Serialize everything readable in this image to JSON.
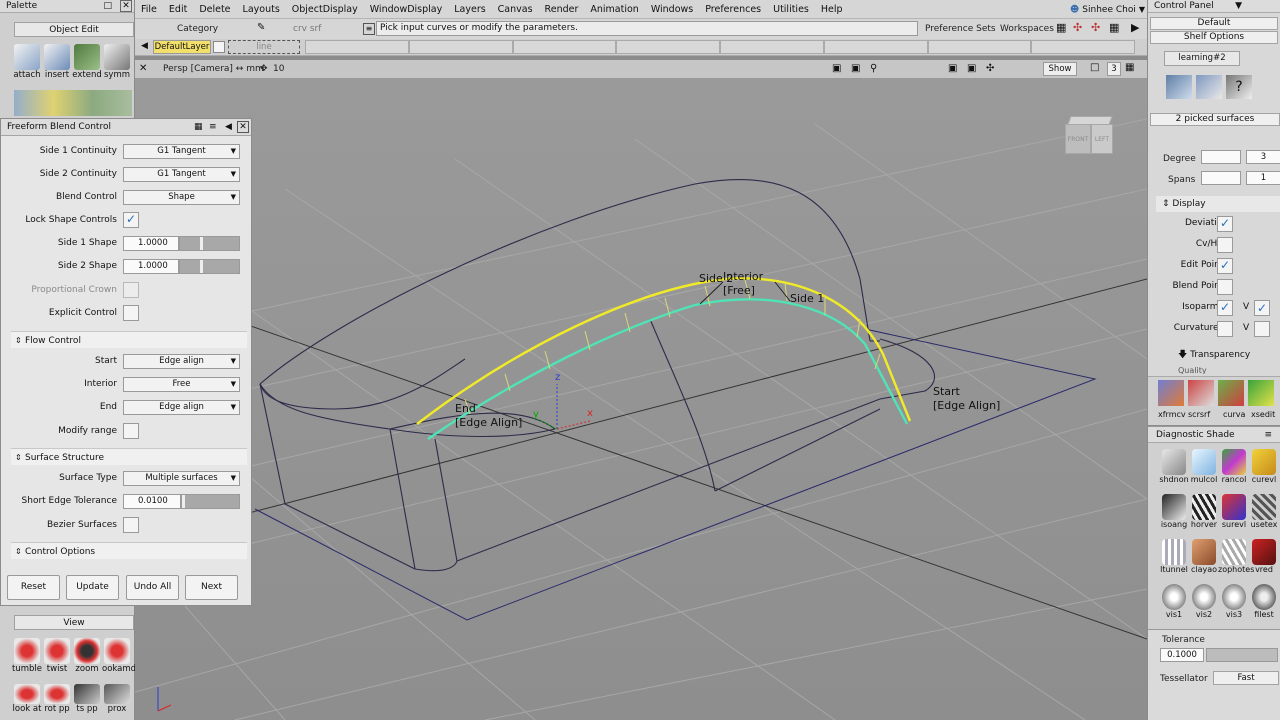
{
  "menu": [
    "File",
    "Edit",
    "Delete",
    "Layouts",
    "ObjectDisplay",
    "WindowDisplay",
    "Layers",
    "Canvas",
    "Render",
    "Animation",
    "Windows",
    "Preferences",
    "Utilities",
    "Help"
  ],
  "user": "Sinhee Choi",
  "toolbar": {
    "category_label": "Category",
    "recent_tool": "crv srf",
    "prompt": "Pick input curves or modify the parameters.",
    "preference_sets": "Preference Sets",
    "workspaces": "Workspaces",
    "layer_name": "DefaultLayer",
    "layer_field": "line"
  },
  "viewport": {
    "camera": "Persp [Camera] ↔ mm",
    "grid_snap": "10",
    "show_label": "Show",
    "count": "3",
    "cube_front": "FRONT",
    "cube_left": "LEFT",
    "labels": {
      "side2": "Side 2",
      "interior": "Interior",
      "free": "[Free]",
      "side1": "Side 1",
      "end": "End",
      "end_align": "[Edge Align]",
      "start": "Start",
      "start_align": "[Edge Align]",
      "axis_x": "x",
      "axis_y": "y",
      "axis_z": "z"
    }
  },
  "palette": {
    "title": "Palette",
    "tab_object_edit": "Object Edit",
    "tools": [
      "attach",
      "insert",
      "extend",
      "symm"
    ],
    "tab_view": "View",
    "view_tools": [
      "tumble",
      "twist",
      "zoom",
      "ookamd"
    ],
    "view_tools2": [
      "look at",
      "rot pp",
      "ts pp",
      "prox"
    ]
  },
  "fbc": {
    "title": "Freeform Blend Control",
    "side1_continuity": {
      "label": "Side 1 Continuity",
      "value": "G1 Tangent"
    },
    "side2_continuity": {
      "label": "Side 2 Continuity",
      "value": "G1 Tangent"
    },
    "blend_control": {
      "label": "Blend Control",
      "value": "Shape"
    },
    "lock_shape": {
      "label": "Lock Shape Controls",
      "checked": true
    },
    "side1_shape": {
      "label": "Side 1 Shape",
      "value": "1.0000"
    },
    "side2_shape": {
      "label": "Side 2 Shape",
      "value": "1.0000"
    },
    "proportional_crown": {
      "label": "Proportional Crown"
    },
    "explicit_control": {
      "label": "Explicit Control"
    },
    "flow_control": "Flow Control",
    "start": {
      "label": "Start",
      "value": "Edge align"
    },
    "interior": {
      "label": "Interior",
      "value": "Free"
    },
    "end": {
      "label": "End",
      "value": "Edge align"
    },
    "modify_range": {
      "label": "Modify range"
    },
    "surface_structure": "Surface Structure",
    "surface_type": {
      "label": "Surface Type",
      "value": "Multiple surfaces"
    },
    "short_edge": {
      "label": "Short Edge Tolerance",
      "value": "0.0100"
    },
    "bezier": {
      "label": "Bezier Surfaces"
    },
    "control_options": "Control Options",
    "buttons": {
      "reset": "Reset",
      "update": "Update",
      "undo_all": "Undo All",
      "next": "Next"
    }
  },
  "cpanel": {
    "title": "Control Panel",
    "default": "Default",
    "shelf_options": "Shelf Options",
    "shelf_tab": "learning#2",
    "picked": "2 picked surfaces",
    "degree_label": "Degree",
    "degree_value": "3",
    "spans_label": "Spans",
    "spans_value": "1",
    "display": "Display",
    "rows": [
      {
        "label": "Deviation",
        "checked": true
      },
      {
        "label": "Cv/Hull",
        "checked": false
      },
      {
        "label": "Edit Points",
        "checked": true
      },
      {
        "label": "Blend Points",
        "checked": false
      },
      {
        "label": "Isoparm U",
        "checked": true
      },
      {
        "label": "Curvature U",
        "checked": false
      }
    ],
    "v_label": "V",
    "transparency": "Transparency",
    "quality": "Quality",
    "shelf_tools": [
      "xfrmcv",
      "scrsrf",
      "curva",
      "xsedit"
    ]
  },
  "diag": {
    "title": "Diagnostic Shade",
    "tools": [
      "shdnon",
      "mulcol",
      "rancol",
      "curevl",
      "isoang",
      "horver",
      "surevl",
      "usetex",
      "ltunnel",
      "clayao",
      "zophotes",
      "vred",
      "vis1",
      "vis2",
      "vis3",
      "filest"
    ]
  },
  "tess": {
    "tolerance_label": "Tolerance",
    "tolerance_value": "0.1000",
    "tessellator_label": "Tessellator",
    "tessellator_value": "Fast"
  }
}
